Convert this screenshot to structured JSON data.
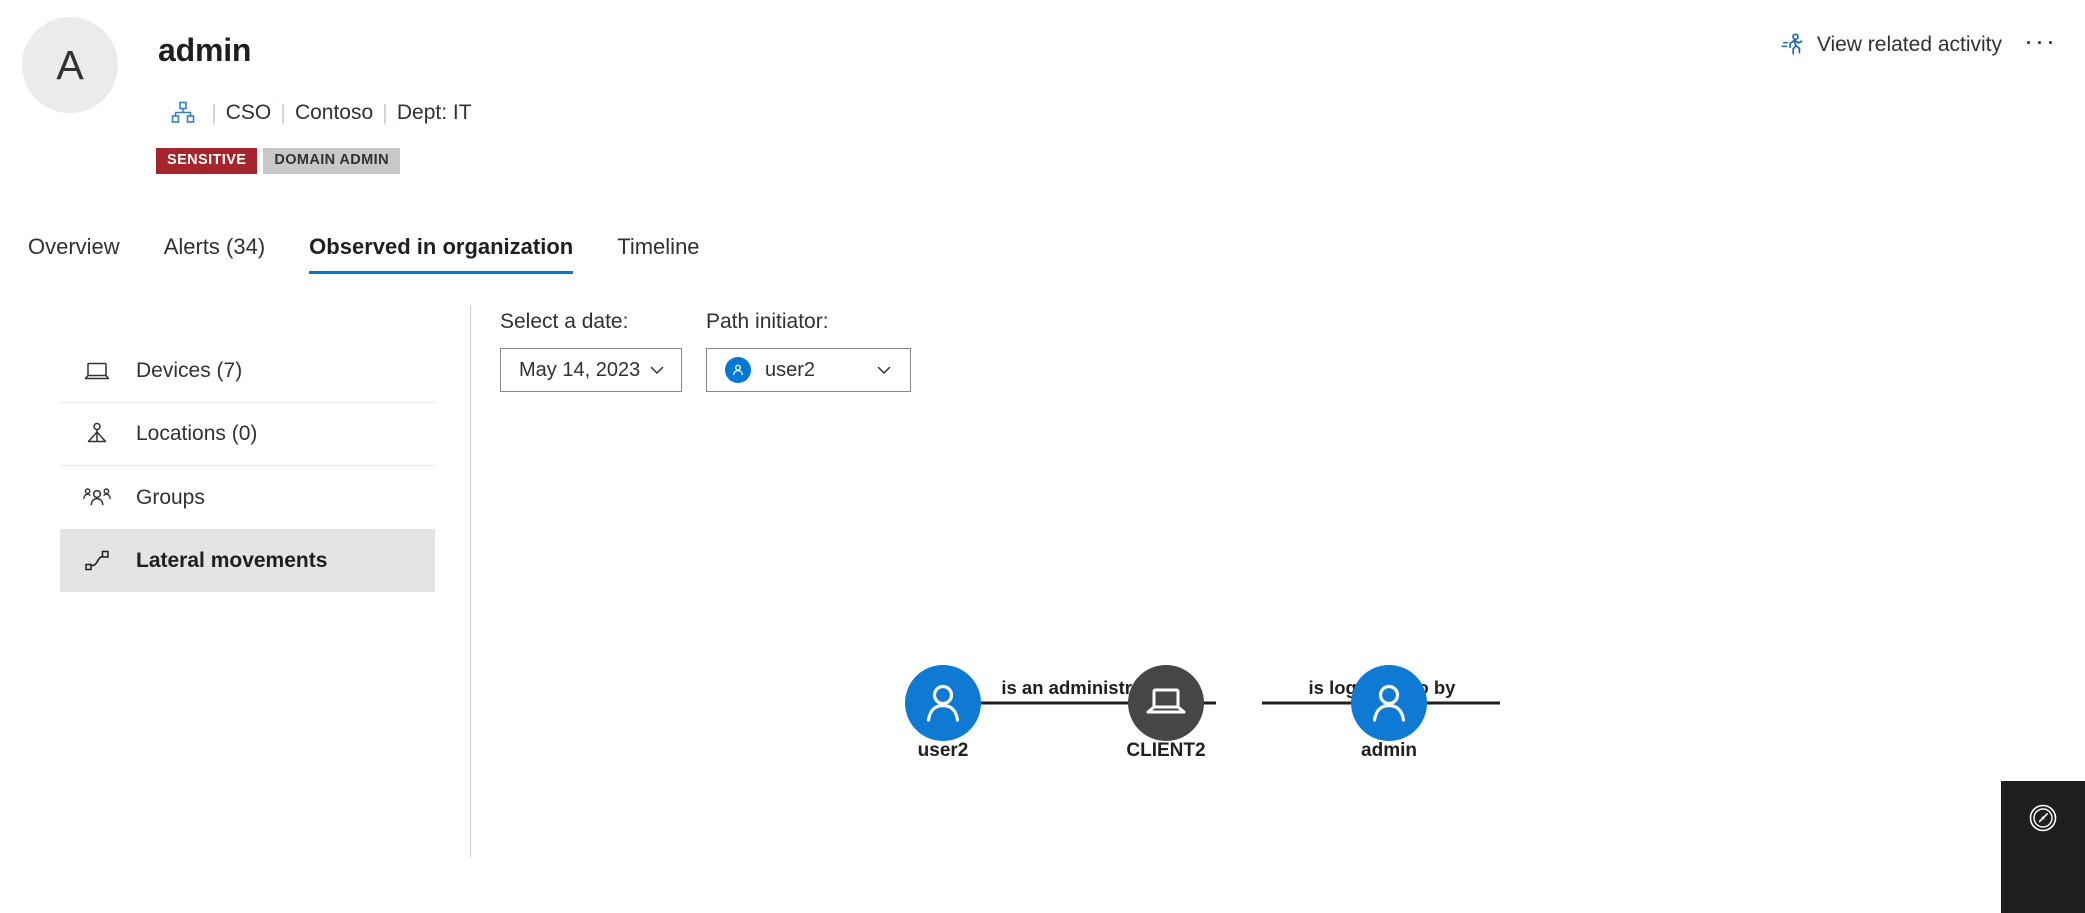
{
  "header": {
    "avatar_letter": "A",
    "title": "admin",
    "meta": {
      "org_icon": "org-hierarchy-icon",
      "items": [
        "CSO",
        "Contoso",
        "Dept: IT"
      ],
      "separator": "|"
    },
    "badges": [
      {
        "label": "SENSITIVE",
        "style": "sensitive",
        "color": "#a4262c"
      },
      {
        "label": "DOMAIN ADMIN",
        "style": "neutral",
        "color": "#c8c8c8"
      }
    ],
    "actions": {
      "view_related_activity": "View related activity",
      "view_related_activity_icon": "running-person-icon",
      "more_menu": "···"
    }
  },
  "tabs": [
    {
      "label": "Overview",
      "active": false
    },
    {
      "label": "Alerts (34)",
      "active": false
    },
    {
      "label": "Observed in organization",
      "active": true
    },
    {
      "label": "Timeline",
      "active": false
    }
  ],
  "entity_nav": [
    {
      "label": "Devices (7)",
      "icon": "laptop-icon",
      "selected": false
    },
    {
      "label": "Locations (0)",
      "icon": "location-person-icon",
      "selected": false
    },
    {
      "label": "Groups",
      "icon": "people-group-icon",
      "selected": false
    },
    {
      "label": "Lateral movements",
      "icon": "lateral-movement-icon",
      "selected": true
    }
  ],
  "filters": {
    "date": {
      "label": "Select a date:",
      "value": "May 14, 2023",
      "chevron": "chevron-down-icon"
    },
    "initiator": {
      "label": "Path initiator:",
      "value": "user2",
      "avatar_icon": "user-icon",
      "chevron": "chevron-down-icon"
    }
  },
  "graph": {
    "accent_blue": "#0f7ad4",
    "device_dark": "#484644",
    "edge_color": "#201f1e",
    "nodes": [
      {
        "id": "user2",
        "label": "user2",
        "type": "user",
        "color": "#0f7ad4"
      },
      {
        "id": "CLIENT2",
        "label": "CLIENT2",
        "type": "device",
        "color": "#484644"
      },
      {
        "id": "admin",
        "label": "admin",
        "type": "user",
        "color": "#0f7ad4"
      }
    ],
    "edges": [
      {
        "from": "user2",
        "to": "CLIENT2",
        "label": "is an administrator on"
      },
      {
        "from": "CLIENT2",
        "to": "admin",
        "label": "is logged into by"
      }
    ]
  },
  "assistant_widget": {
    "icon": "gauge-icon",
    "background": "#201f1e"
  }
}
